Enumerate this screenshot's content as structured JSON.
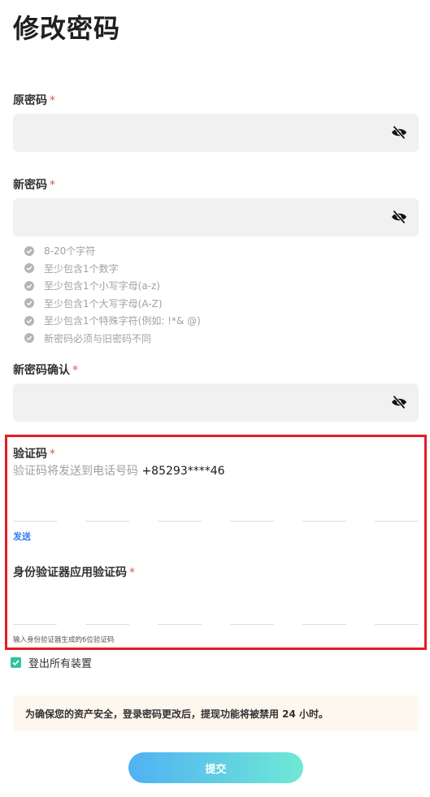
{
  "page": {
    "title": "修改密码"
  },
  "old_password": {
    "label": "原密码",
    "required_mark": "*",
    "value": ""
  },
  "new_password": {
    "label": "新密码",
    "required_mark": "*",
    "value": "",
    "rules": [
      "8-20个字符",
      "至少包含1个数字",
      "至少包含1个小写字母(a-z)",
      "至少包含1个大写字母(A-Z)",
      "至少包含1个特殊字符(例如: !*& @)",
      "新密码必须与旧密码不同"
    ]
  },
  "confirm_password": {
    "label": "新密码确认",
    "required_mark": "*",
    "value": ""
  },
  "sms_code": {
    "label": "验证码",
    "required_mark": "*",
    "hint": "验证码将发送到电话号码",
    "phone": "+85293****46",
    "send_label": "发送"
  },
  "auth_code": {
    "label": "身份验证器应用验证码",
    "required_mark": "*",
    "hint": "输入身份验证器生成的6位验证码"
  },
  "logout_all": {
    "label": "登出所有装置",
    "checked": true
  },
  "notice": {
    "text": "为确保您的资产安全，登录密码更改后，提现功能将被禁用 24 小时。"
  },
  "submit": {
    "label": "提交"
  },
  "colors": {
    "accent_gradient_start": "#50b1f3",
    "accent_gradient_end": "#6fe8d6",
    "required": "#e0564f",
    "link": "#2f7bf5",
    "highlight_border": "#e01e25"
  }
}
